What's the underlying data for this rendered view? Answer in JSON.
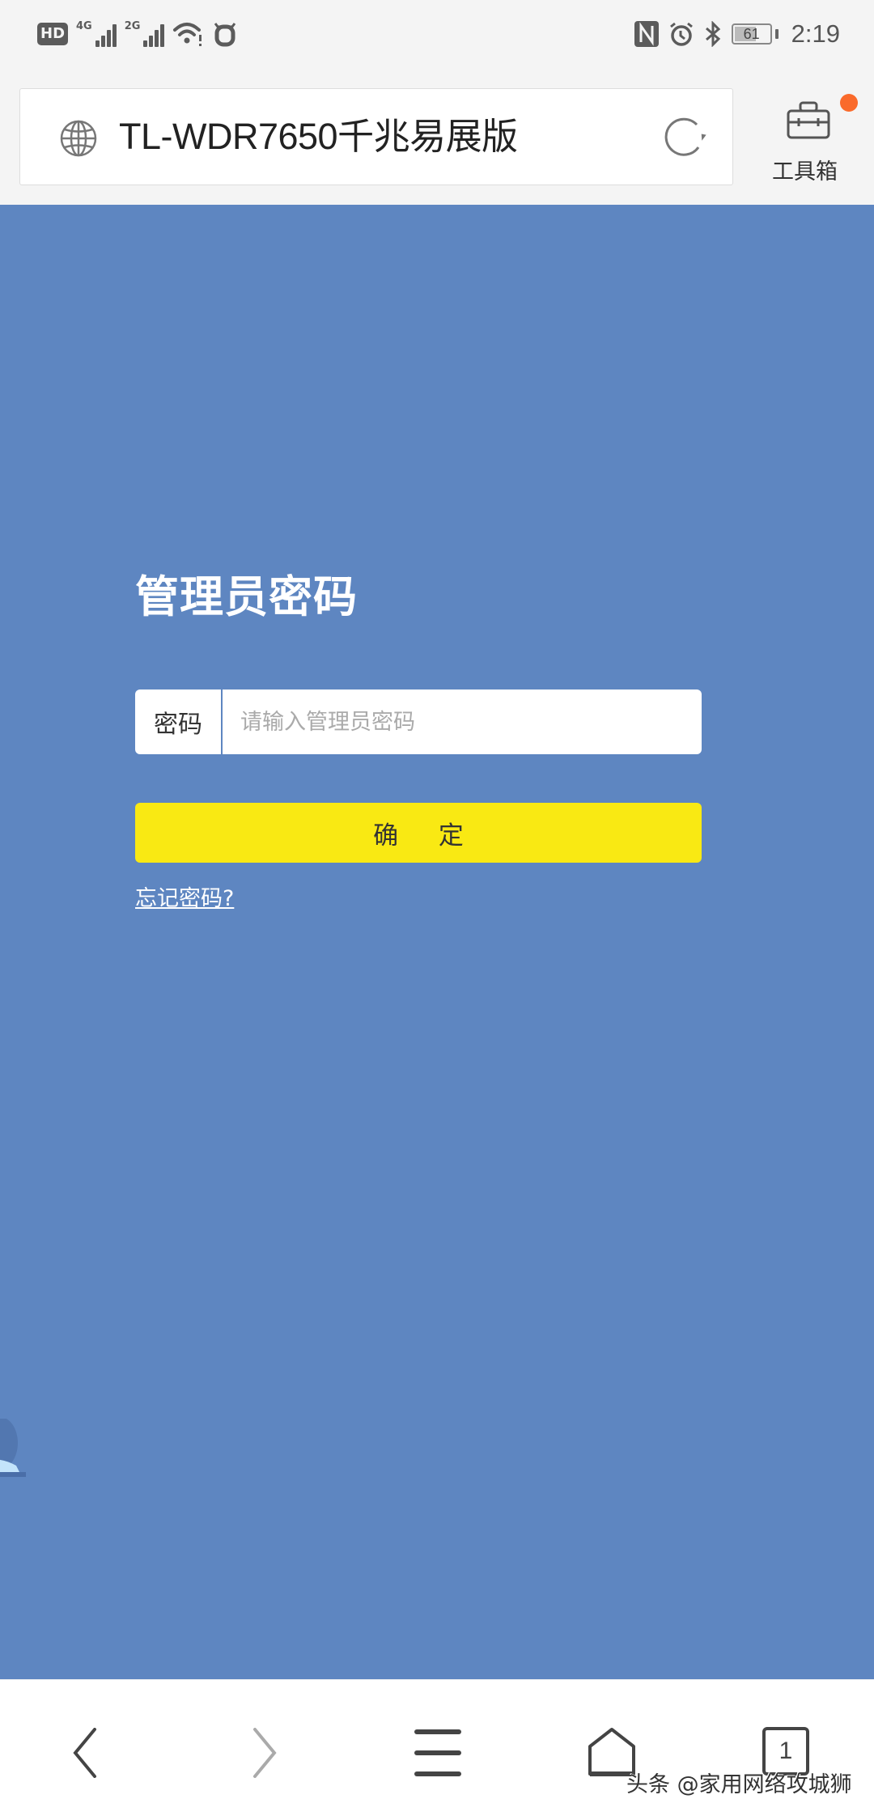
{
  "status_bar": {
    "hd_badge": "HD",
    "network_1": "4G",
    "network_2": "2G",
    "battery_percent": 61,
    "battery_label": "61",
    "time": "2:19",
    "icons": [
      "hd-icon",
      "signal-4g-icon",
      "signal-2g-icon",
      "wifi-warning-icon",
      "cow-app-icon",
      "nfc-icon",
      "alarm-icon",
      "bluetooth-icon",
      "battery-icon"
    ]
  },
  "browser": {
    "page_title": "TL-WDR7650千兆易展版",
    "toolbox_label": "工具箱",
    "toolbox_notification": true,
    "colors": {
      "notification_dot": "#fa6a2b"
    }
  },
  "login": {
    "title": "管理员密码",
    "password_label": "密码",
    "password_placeholder": "请输入管理员密码",
    "password_value": "",
    "confirm_label": "确 定",
    "forgot_link": "忘记密码?",
    "colors": {
      "background": "#5e86c1",
      "confirm_button": "#f9e913"
    }
  },
  "bottom_nav": {
    "tab_count": "1",
    "items": [
      "back",
      "forward",
      "menu",
      "home",
      "tabs"
    ],
    "forward_enabled": false
  },
  "watermark": "头条 @家用网络攻城狮"
}
